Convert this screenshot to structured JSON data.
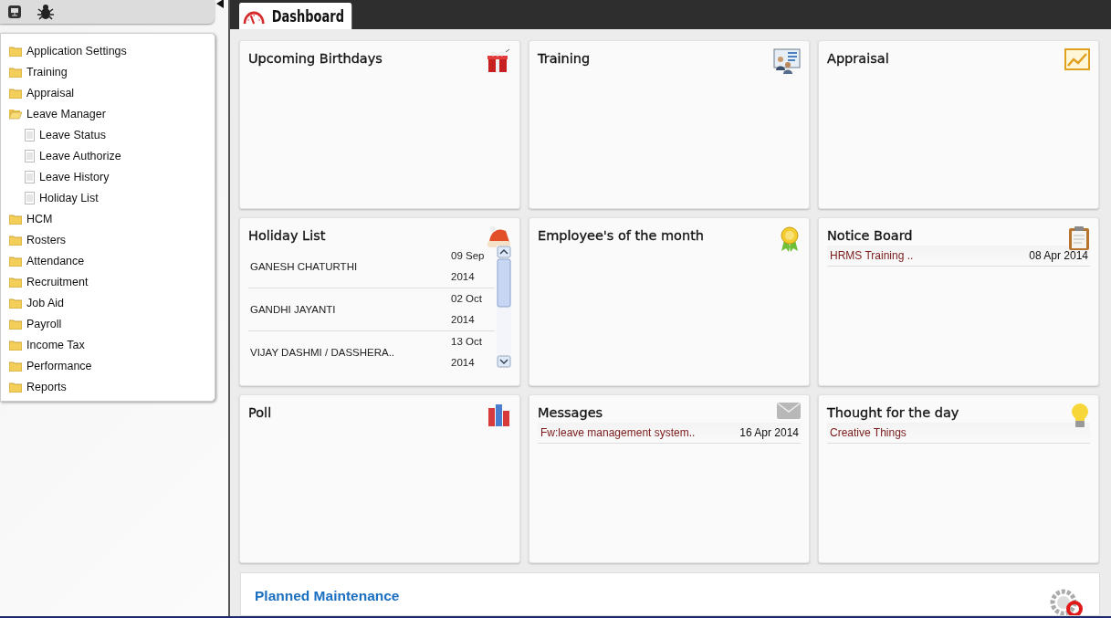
{
  "sidebar": {
    "tree": [
      {
        "label": "Application Settings",
        "expanded": false
      },
      {
        "label": "Training",
        "expanded": false
      },
      {
        "label": "Appraisal",
        "expanded": false
      },
      {
        "label": "Leave Manager",
        "expanded": true,
        "children": [
          {
            "label": "Leave Status"
          },
          {
            "label": "Leave Authorize"
          },
          {
            "label": "Leave History"
          },
          {
            "label": "Holiday List"
          }
        ]
      },
      {
        "label": "HCM",
        "expanded": false
      },
      {
        "label": "Rosters",
        "expanded": false
      },
      {
        "label": "Attendance",
        "expanded": false
      },
      {
        "label": "Recruitment",
        "expanded": false
      },
      {
        "label": "Job Aid",
        "expanded": false
      },
      {
        "label": "Payroll",
        "expanded": false
      },
      {
        "label": "Income Tax",
        "expanded": false
      },
      {
        "label": "Performance",
        "expanded": false
      },
      {
        "label": "Reports",
        "expanded": false
      }
    ]
  },
  "tabs": [
    {
      "label": "Dashboard",
      "selected": true
    }
  ],
  "widgets": [
    {
      "title": "Upcoming Birthdays",
      "kind": "empty"
    },
    {
      "title": "Training",
      "kind": "empty"
    },
    {
      "title": "Appraisal",
      "kind": "empty"
    },
    {
      "title": "Holiday List",
      "kind": "holidays",
      "items": [
        {
          "name": "GANESH CHATURTHI",
          "date": "09 Sep 2014"
        },
        {
          "name": "GANDHI JAYANTI",
          "date": "02 Oct 2014"
        },
        {
          "name": "VIJAY DASHMI / DASSHERA..",
          "date": "13 Oct 2014"
        }
      ]
    },
    {
      "title": "Employee's of the month",
      "kind": "empty"
    },
    {
      "title": "Notice Board",
      "kind": "list",
      "items": [
        {
          "text": "HRMS Training ..",
          "date": "08 Apr 2014"
        }
      ]
    },
    {
      "title": "Poll",
      "kind": "empty"
    },
    {
      "title": "Messages",
      "kind": "list",
      "items": [
        {
          "text": "Fw:leave management system..",
          "date": "16 Apr 2014"
        }
      ]
    },
    {
      "title": "Thought for the day",
      "kind": "list",
      "items": [
        {
          "text": "Creative Things"
        }
      ]
    }
  ],
  "maintenance": {
    "title": "Planned Maintenance"
  }
}
